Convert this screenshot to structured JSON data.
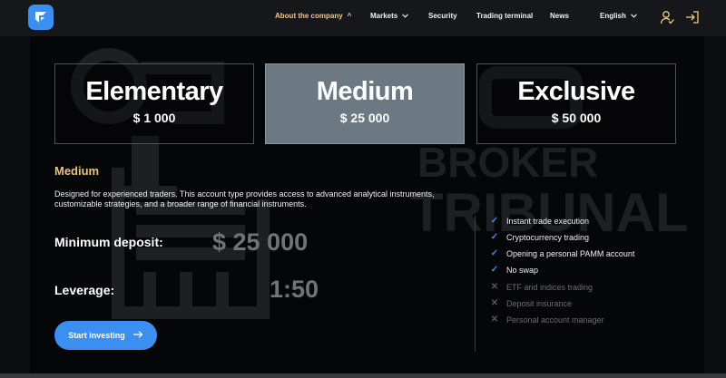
{
  "header": {
    "nav": [
      {
        "label": "About the company",
        "has_chevron": true,
        "chevron": "^",
        "active": true
      },
      {
        "label": "Markets",
        "has_chevron": true,
        "chevron": "⌄",
        "active": false
      },
      {
        "label": "Security",
        "has_chevron": false,
        "active": false
      },
      {
        "label": "Trading terminal",
        "has_chevron": false,
        "active": false
      },
      {
        "label": "News",
        "has_chevron": false,
        "active": false
      }
    ],
    "language": "English",
    "icons": [
      "user-icon",
      "sign-in-icon"
    ],
    "accent_color": "#f2c98b"
  },
  "watermark": {
    "line1": "BROKER",
    "line2": "TRIBUNAL"
  },
  "accounts": [
    {
      "name": "Elementary",
      "price": "$ 1 000",
      "selected": false
    },
    {
      "name": "Medium",
      "price": "$ 25 000",
      "selected": true
    },
    {
      "name": "Exclusive",
      "price": "$ 50 000",
      "selected": false
    }
  ],
  "plan": {
    "title": "Medium",
    "description": "Designed for experienced traders. This account type provides access to advanced analytical instruments, customizable strategies, and a broader range of financial instruments.",
    "min_deposit_label": "Minimum deposit:",
    "min_deposit_value": "$ 25 000",
    "leverage_label": "Leverage:",
    "leverage_value": "1:50",
    "cta_label": "Start investing"
  },
  "features": [
    {
      "label": "Instant trade execution",
      "included": true
    },
    {
      "label": "Cryptocurrency trading",
      "included": true
    },
    {
      "label": "Opening a personal PAMM account",
      "included": true
    },
    {
      "label": "No swap",
      "included": true
    },
    {
      "label": "ETF and indices trading",
      "included": false
    },
    {
      "label": "Deposit insurance",
      "included": false
    },
    {
      "label": "Personal account manager",
      "included": false
    }
  ],
  "colors": {
    "brand_blue": "#3a8ff0",
    "gold": "#efc27a",
    "muted_value": "#6d747b"
  }
}
